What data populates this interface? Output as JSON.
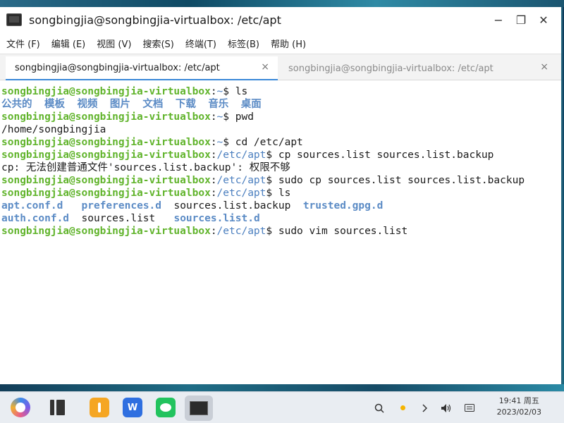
{
  "window": {
    "title": "songbingjia@songbingjia-virtualbox: /etc/apt",
    "controls": {
      "minimize": "−",
      "maximize": "❐",
      "close": "✕"
    }
  },
  "menu": {
    "items": [
      "文件 (F)",
      "编辑 (E)",
      "视图 (V)",
      "搜索(S)",
      "终端(T)",
      "标签(B)",
      "帮助 (H)"
    ]
  },
  "tabs": [
    {
      "label": "songbingjia@songbingjia-virtualbox: /etc/apt",
      "close": "×"
    },
    {
      "label": "songbingjia@songbingjia-virtualbox: /etc/apt",
      "close": "×"
    }
  ],
  "terminal": {
    "user_host": "songbingjia@songbingjia-virtualbox",
    "lines": [
      {
        "path": "~",
        "cmd": " ls"
      },
      {
        "output_dirs": [
          "公共的",
          "模板",
          "视频",
          "图片",
          "文档",
          "下载",
          "音乐",
          "桌面"
        ]
      },
      {
        "path": "~",
        "cmd": " pwd"
      },
      {
        "output": "/home/songbingjia"
      },
      {
        "path": "~",
        "cmd": " cd /etc/apt"
      },
      {
        "path": "/etc/apt",
        "cmd": " cp sources.list sources.list.backup"
      },
      {
        "output": "cp: 无法创建普通文件'sources.list.backup': 权限不够"
      },
      {
        "path": "/etc/apt",
        "cmd": " sudo cp sources.list sources.list.backup"
      },
      {
        "path": "/etc/apt",
        "cmd": " ls"
      },
      {
        "ls_row": [
          "apt.conf.d",
          "preferences.d",
          "sources.list.backup",
          "trusted.gpg.d"
        ]
      },
      {
        "ls_row": [
          "auth.conf.d",
          "sources.list",
          "sources.list.d"
        ]
      },
      {
        "path": "/etc/apt",
        "cmd": " sudo vim sources.list"
      }
    ]
  },
  "taskbar": {
    "icons": [
      "start-menu-icon",
      "multitask-view-icon",
      "file-manager-icon",
      "wps-office-icon",
      "wechat-icon",
      "terminal-icon"
    ],
    "tray": {
      "search": "search-icon",
      "weather": "sun-icon",
      "expand": "chevron-right-icon",
      "volume": "volume-icon",
      "keyboard": "keyboard-icon"
    },
    "clock": {
      "time": "19:41 周五",
      "date": "2023/02/03"
    }
  },
  "colors": {
    "prompt_user": "#61b42c",
    "prompt_path": "#4b7fbf",
    "directory": "#5b8bc5",
    "tab_accent": "#3a88d8"
  }
}
